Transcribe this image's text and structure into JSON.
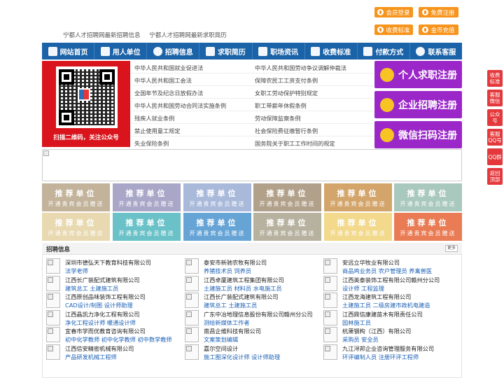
{
  "top": {
    "links": [
      "宁都人才招聘网最新招聘信息",
      "宁都人才招聘网最新求职简历"
    ],
    "buttons": {
      "login": "会员登录",
      "register": "免费注册",
      "pricing": "收费标准",
      "recharge": "金币充值"
    }
  },
  "nav": [
    "网站首页",
    "用人单位",
    "招聘信息",
    "求职简历",
    "职场资讯",
    "收费标准",
    "付款方式",
    "联系客服"
  ],
  "qr": {
    "caption": "扫描二维码，关注公众号"
  },
  "laws": [
    [
      "中华人民共和国就业促进法",
      "中华人民共和国劳动争议调解仲裁法"
    ],
    [
      "中华人民共和国工会法",
      "保障农民工工资支付条例"
    ],
    [
      "全国年节及纪念日放假办法",
      "女职工劳动保护特别规定"
    ],
    [
      "中华人民共和国劳动合同法实施条例",
      "职工带薪年休假条例"
    ],
    [
      "残疾人就业条例",
      "劳动保障监察条例"
    ],
    [
      "禁止使用童工规定",
      "社会保险费征缴暂行条例"
    ],
    [
      "失业保险条例",
      "国务院关于职工工作时间的规定"
    ]
  ],
  "big_buttons": [
    "个人求职注册",
    "企业招聘注册",
    "微信扫码注册"
  ],
  "side": [
    "收费标准",
    "客服微信",
    "公众号",
    "客服QQ号",
    "QQ群",
    "返回顶部"
  ],
  "recommend": {
    "title": "推荐单位",
    "sub": "开通贵宾会员赠送",
    "colors": [
      "#c2b39a",
      "#a9a7c8",
      "#a9b9da",
      "#b2a18a",
      "#d4a56b",
      "#a9c8be",
      "#e8d9b0",
      "#6ac2c8",
      "#67a4d6",
      "#b7b2a0",
      "#f2d98b",
      "#e97c55"
    ]
  },
  "jobs": {
    "title": "招聘信息",
    "more": "更多",
    "items": [
      {
        "company": "深圳市德弘天下教育科技有限公司",
        "positions": "法学老师"
      },
      {
        "company": "泰安市新驰农牧有限公司",
        "positions": "养猪技术员  饲养员"
      },
      {
        "company": "安远立华牧业有限公司",
        "positions": "商品鸡业务员  农户管理员  养禽兽医"
      },
      {
        "company": "江西长广装配式建筑有限公司",
        "positions": "建筑总工  土建施工员"
      },
      {
        "company": "江西卓厦建筑工程集团有限公司",
        "positions": "土建施工员  材料员  水电施工员"
      },
      {
        "company": "江西英泰装饰工程有限公司赣州分公司",
        "positions": "设计师  工程监理"
      },
      {
        "company": "江西原创品味装饰工程有限公司",
        "positions": "CAD设计/制图  设计师助理"
      },
      {
        "company": "江西长广装配式建筑有限公司",
        "positions": "建筑总工  土建施工员"
      },
      {
        "company": "江西龙海建筑工程有限公司",
        "positions": "土建施工员  二级房建市政机电建造"
      },
      {
        "company": "江西晶凯力净化工程有限公司",
        "positions": "净化工程设计师  暖通设计师"
      },
      {
        "company": "广东中冶地理信息股份有限公司赣州分公司",
        "positions": "测绘新媒体工作者"
      },
      {
        "company": "江西鼎信康建苗木有限责任公司",
        "positions": "园林施工员"
      },
      {
        "company": "宜春市学而优教育咨询有限公司",
        "positions": "初中化学教师  初中化学教师  初中数学教师"
      },
      {
        "company": "南昌企维科技有限公司",
        "positions": "文案策划编辑"
      },
      {
        "company": "杭萧钢构（江西）有限公司",
        "positions": "采购员  安全员"
      },
      {
        "company": "江西信安精密机械有限公司",
        "positions": "产品研发机械工程师"
      },
      {
        "company": "嘉尔空间设计",
        "positions": "施工图深化设计师  设计师助理"
      },
      {
        "company": "九江浔邦企业咨询管理服务有限公司",
        "positions": "环评编制人员  注册环评工程师"
      }
    ]
  }
}
